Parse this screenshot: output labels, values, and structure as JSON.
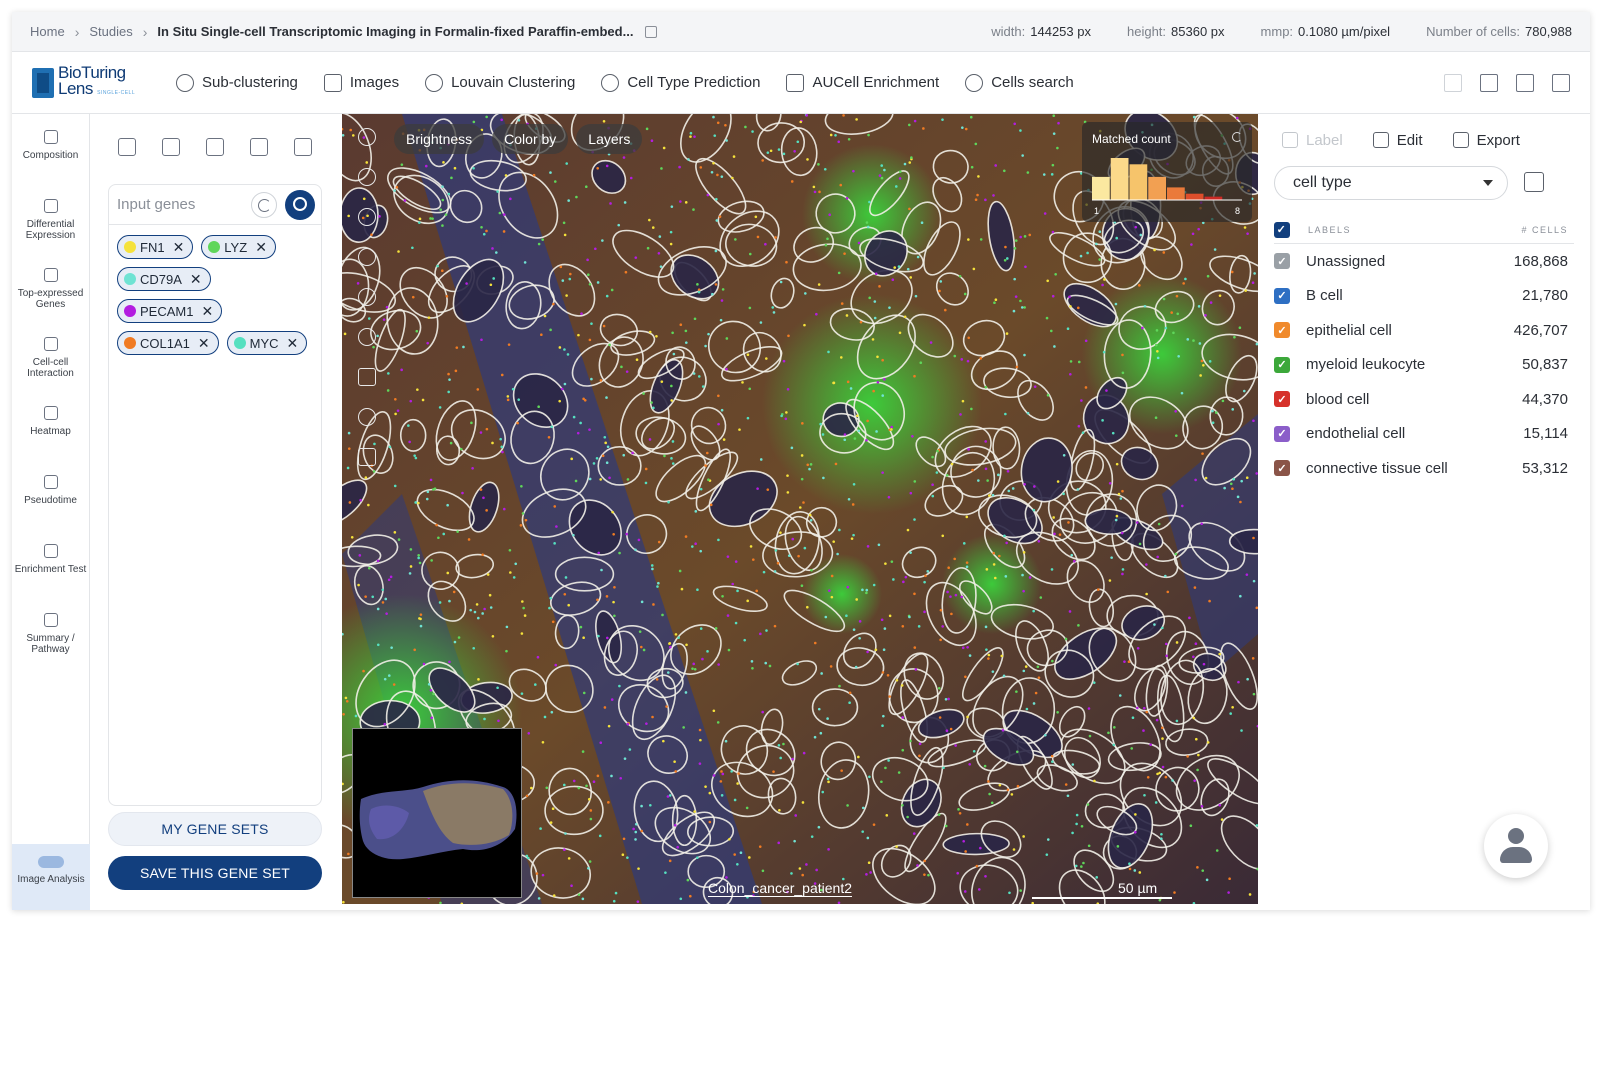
{
  "breadcrumb": {
    "home": "Home",
    "studies": "Studies",
    "current": "In Situ Single-cell Transcriptomic Imaging in Formalin-fixed Paraffin-embed..."
  },
  "meta": [
    {
      "key": "width:",
      "value": "144253 px"
    },
    {
      "key": "height:",
      "value": "85360 px"
    },
    {
      "key": "mmp:",
      "value": "0.1080 µm/pixel"
    },
    {
      "key": "Number of cells:",
      "value": "780,988"
    }
  ],
  "logo": {
    "word1": "BioTuring",
    "word2": "Lens",
    "sub": "SINGLE-CELL"
  },
  "toolbar": {
    "items": [
      "Sub-clustering",
      "Images",
      "Louvain Clustering",
      "Cell Type Prediction",
      "AUCell Enrichment",
      "Cells search"
    ],
    "icons": [
      "subcluster-icon",
      "images-icon",
      "louvain-icon",
      "cell-prediction-icon",
      "aucell-icon",
      "cells-search-icon"
    ]
  },
  "rail": {
    "items": [
      "Composition",
      "Differential Expression",
      "Top-expressed Genes",
      "Cell-cell Interaction",
      "Heatmap",
      "Pseudotime",
      "Enrichment Test",
      "Summary / Pathway"
    ],
    "active": "Image Analysis"
  },
  "genes": {
    "placeholder": "Input genes",
    "chips": [
      {
        "name": "FN1",
        "color": "#f5e23b"
      },
      {
        "name": "LYZ",
        "color": "#5fd65a"
      },
      {
        "name": "CD79A",
        "color": "#6fe3d3"
      },
      {
        "name": "PECAM1",
        "color": "#b31de0"
      },
      {
        "name": "COL1A1",
        "color": "#f07b23"
      },
      {
        "name": "MYC",
        "color": "#55e0c0"
      }
    ],
    "my_gene_sets": "MY GENE SETS",
    "save_gene_set": "SAVE THIS GENE SET"
  },
  "viewer": {
    "buttons": [
      "Brightness",
      "Color by",
      "Layers"
    ],
    "matched_title": "Matched count",
    "matched_lo": "1",
    "matched_hi": "8",
    "histogram": [
      {
        "value": 0.55,
        "color": "#fbe8a0"
      },
      {
        "value": 1.0,
        "color": "#fbd98a"
      },
      {
        "value": 0.85,
        "color": "#f6c46b"
      },
      {
        "value": 0.55,
        "color": "#f2a052"
      },
      {
        "value": 0.3,
        "color": "#ea7a3a"
      },
      {
        "value": 0.15,
        "color": "#de4e2b"
      },
      {
        "value": 0.08,
        "color": "#cc2a24"
      }
    ],
    "caption": "Colon_cancer_patient2",
    "scale": "50 µm"
  },
  "right": {
    "label_btn": "Label",
    "edit_btn": "Edit",
    "export_btn": "Export",
    "select_value": "cell type",
    "col_labels": "LABELS",
    "col_cells": "# CELLS",
    "rows": [
      {
        "label": "Unassigned",
        "count": "168,868",
        "color": "#9aa0a6"
      },
      {
        "label": "B cell",
        "count": "21,780",
        "color": "#2e6fc3"
      },
      {
        "label": "epithelial cell",
        "count": "426,707",
        "color": "#f08a2c"
      },
      {
        "label": "myeloid leukocyte",
        "count": "50,837",
        "color": "#3ca83a"
      },
      {
        "label": "blood cell",
        "count": "44,370",
        "color": "#d6312a"
      },
      {
        "label": "endothelial cell",
        "count": "15,114",
        "color": "#8b5ec9"
      },
      {
        "label": "connective tissue cell",
        "count": "53,312",
        "color": "#8a5448"
      }
    ]
  }
}
